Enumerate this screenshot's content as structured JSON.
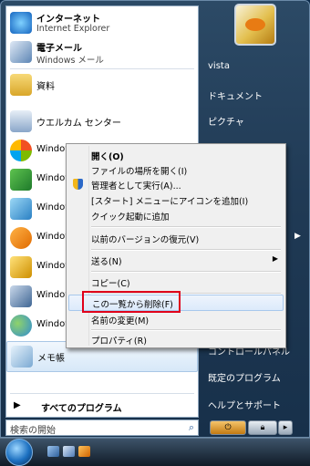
{
  "start_menu": {
    "pinned": [
      {
        "title": "インターネット",
        "subtitle": "Internet Explorer"
      },
      {
        "title": "電子メール",
        "subtitle": "Windows メール"
      }
    ],
    "recent": [
      {
        "label": "資料"
      },
      {
        "label": "ウエルカム センター"
      },
      {
        "label": "Window"
      },
      {
        "label": "Window"
      },
      {
        "label": "Window"
      },
      {
        "label": "Window"
      },
      {
        "label": "Window"
      },
      {
        "label": "Window"
      },
      {
        "label": "Window"
      },
      {
        "label": "メモ帳"
      }
    ],
    "all_programs": "すべてのプログラム",
    "search_placeholder": "検索の開始"
  },
  "right_pane": {
    "links": [
      "vista",
      "ドキュメント",
      "ピクチャ",
      "コントロールパネル",
      "既定のプログラム",
      "ヘルプとサポート"
    ]
  },
  "context_menu": {
    "items": [
      {
        "label": "開く(O)",
        "bold": true
      },
      {
        "label": "ファイルの場所を開く(I)"
      },
      {
        "label": "管理者として実行(A)...",
        "icon": "uac-shield-icon"
      },
      {
        "label": "[スタート] メニューにアイコンを追加(I)"
      },
      {
        "label": "クイック起動に追加"
      },
      {
        "label": "以前のバージョンの復元(V)"
      },
      {
        "label": "送る(N)",
        "submenu": true
      },
      {
        "label": "コピー(C)"
      },
      {
        "label": "この一覧から削除(F)",
        "highlighted": true
      },
      {
        "label": "名前の変更(M)"
      },
      {
        "label": "プロパティ(R)"
      }
    ]
  },
  "colors": {
    "accent": "#e0001b",
    "frame": "#203a55",
    "highlight": "#dceafb"
  }
}
